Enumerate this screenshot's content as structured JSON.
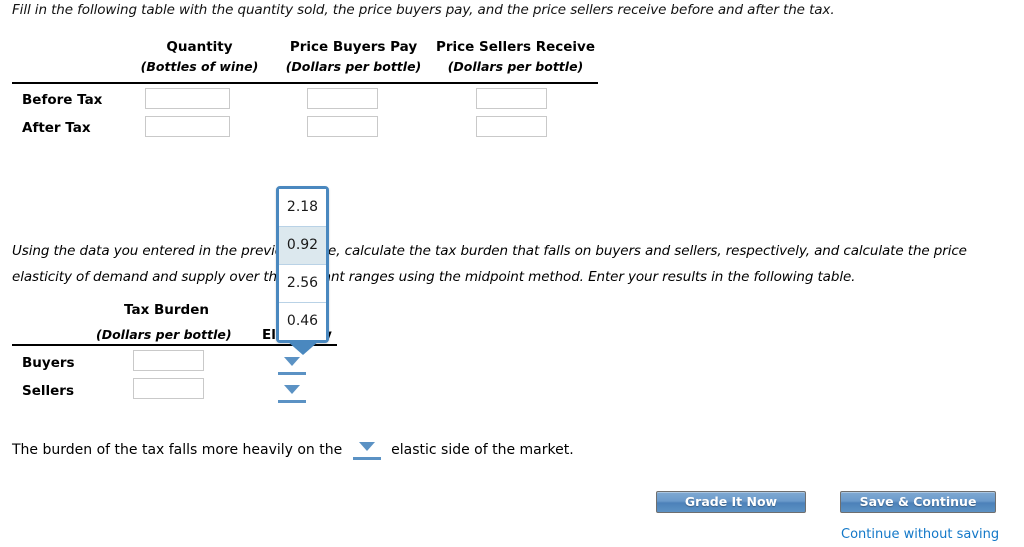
{
  "intro_text": "Fill in the following table with the quantity sold, the price buyers pay, and the price sellers receive before and after the tax.",
  "table1": {
    "columns": [
      {
        "main": "Quantity",
        "sub": "(Bottles of wine)"
      },
      {
        "main": "Price Buyers Pay",
        "sub": "(Dollars per bottle)"
      },
      {
        "main": "Price Sellers Receive",
        "sub": "(Dollars per bottle)"
      }
    ],
    "rows": [
      {
        "label": "Before Tax",
        "values": [
          "",
          "",
          ""
        ]
      },
      {
        "label": "After Tax",
        "values": [
          "",
          "",
          ""
        ]
      }
    ]
  },
  "para2_text": "Using the data you entered in the previous table, calculate the tax burden that falls on buyers and sellers, respectively, and calculate the price elasticity of demand and supply over the relevant ranges using the midpoint method. Enter your results in the following table.",
  "table2": {
    "col1_main": "Tax Burden",
    "col1_sub": "(Dollars per bottle)",
    "col2_main": "Elasticity",
    "rows": [
      {
        "label": "Buyers",
        "value": "",
        "dropdown_value": ""
      },
      {
        "label": "Sellers",
        "value": "",
        "dropdown_value": ""
      }
    ]
  },
  "dropdown_open": {
    "options": [
      "2.18",
      "0.92",
      "2.56",
      "0.46"
    ],
    "selected_index": 1,
    "border_color": "#4a88bf",
    "selected_bg": "#dce8ee"
  },
  "bottom_sentence": {
    "before": "The burden of the tax falls more heavily on the",
    "dropdown_value": "",
    "after": "elastic side of the market."
  },
  "footer": {
    "grade_label": "Grade It Now",
    "save_label": "Save & Continue",
    "continue_link": "Continue without saving",
    "link_color": "#1378c8",
    "button_accent": "#5d92c4"
  }
}
